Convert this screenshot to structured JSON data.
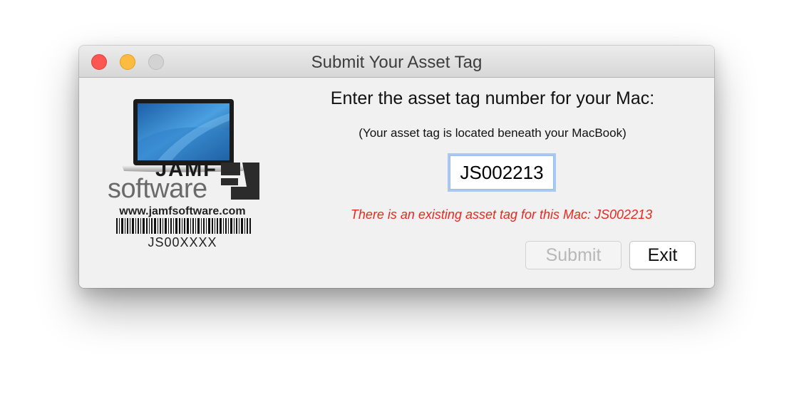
{
  "window": {
    "title": "Submit Your Asset Tag",
    "controls": {
      "close_icon": "close-icon",
      "minimize_icon": "minimize-icon",
      "zoom_icon": "zoom-icon"
    }
  },
  "logo": {
    "image": "macbook-laptop-icon",
    "brand_top": "JAMF",
    "brand_bottom": "software",
    "url": "www.jamfsoftware.com",
    "barcode_icon": "barcode-icon",
    "barcode_text": "JS00XXXX"
  },
  "form": {
    "heading": "Enter the asset tag number for your Mac:",
    "subtext": "(Your asset tag is located beneath your MacBook)",
    "asset_tag_value": "JS002213",
    "error_message": "There is an existing asset tag for this Mac: JS002213",
    "error_color": "#e8281e"
  },
  "buttons": {
    "submit_label": "Submit",
    "submit_disabled": true,
    "exit_label": "Exit"
  }
}
